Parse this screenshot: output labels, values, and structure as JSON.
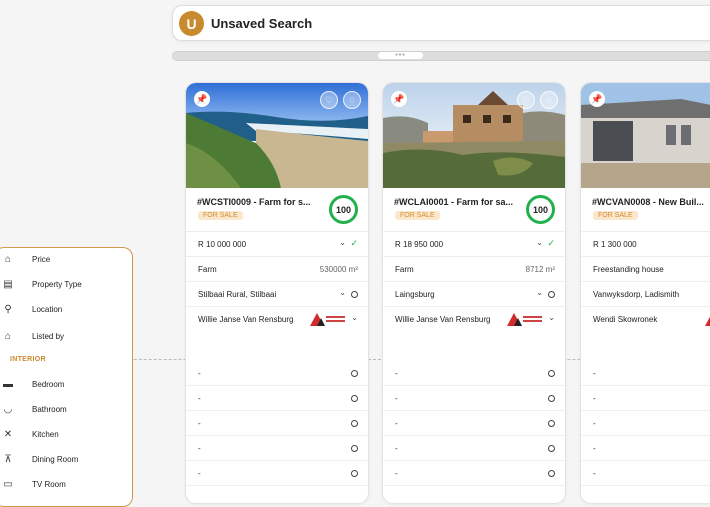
{
  "header": {
    "avatar_initial": "U",
    "title": "Unsaved Search"
  },
  "scrollbar": {
    "thumb_glyph": "•••"
  },
  "filters": {
    "items": [
      {
        "label": "Price",
        "icon": "house-outline-icon",
        "glyph": "⌂"
      },
      {
        "label": "Property Type",
        "icon": "building-icon",
        "glyph": "▤"
      },
      {
        "label": "Location",
        "icon": "location-pin-icon",
        "glyph": "⚲"
      },
      {
        "label": "Listed by",
        "icon": "agent-home-icon",
        "glyph": "⌂"
      }
    ],
    "section_label": "INTERIOR",
    "interior_items": [
      {
        "label": "Bedroom",
        "icon": "bed-icon",
        "glyph": "▬"
      },
      {
        "label": "Bathroom",
        "icon": "bath-icon",
        "glyph": "◡"
      },
      {
        "label": "Kitchen",
        "icon": "kitchen-utensils-icon",
        "glyph": "✕"
      },
      {
        "label": "Dining Room",
        "icon": "dining-table-icon",
        "glyph": "⊼"
      },
      {
        "label": "TV Room",
        "icon": "tv-icon",
        "glyph": "▭"
      }
    ]
  },
  "cards": [
    {
      "title": "#WCSTI0009 - Farm for s...",
      "badge": "FOR SALE",
      "score": "100",
      "price": "R 10 000 000",
      "type": "Farm",
      "size": "530000 m²",
      "location": "Stilbaai Rural, Stilbaai",
      "agent": "Willie Janse Van Rensburg",
      "empty": [
        "-",
        "-",
        "-",
        "-",
        "-"
      ]
    },
    {
      "title": "#WCLAI0001 - Farm for sa...",
      "badge": "FOR SALE",
      "score": "100",
      "price": "R 18 950 000",
      "type": "Farm",
      "size": "8712 m²",
      "location": "Laingsburg",
      "agent": "Willie Janse Van Rensburg",
      "empty": [
        "-",
        "-",
        "-",
        "-",
        "-"
      ]
    },
    {
      "title": "#WCVAN0008 - New Buil...",
      "badge": "FOR SALE",
      "price": "R 1 300 000",
      "type": "Freestanding house",
      "location": "Vanwyksdorp, Ladismith",
      "agent": "Wendi Skowronek",
      "empty": [
        "-",
        "-",
        "-",
        "-",
        "-"
      ]
    }
  ],
  "colors": {
    "accent": "#c88a2e",
    "score_ring": "#22b14c",
    "badge_bg": "#fbe8cc"
  }
}
